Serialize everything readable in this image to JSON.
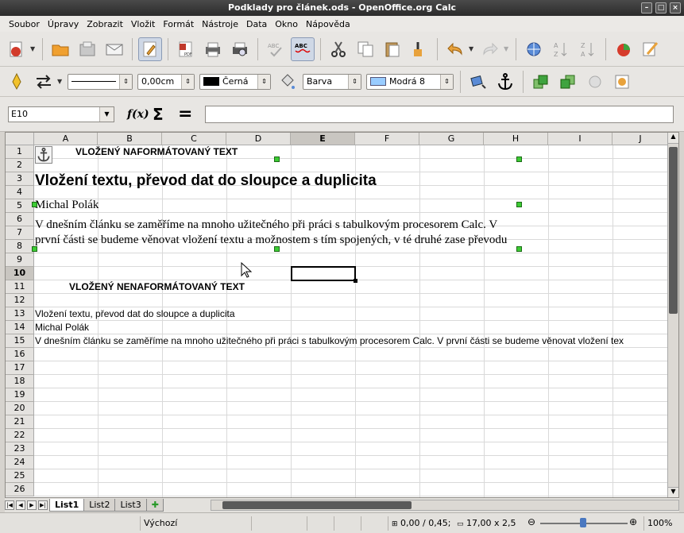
{
  "window": {
    "title": "Podklady pro článek.ods - OpenOffice.org Calc"
  },
  "menu": [
    {
      "label": "Soubor"
    },
    {
      "label": "Úpravy"
    },
    {
      "label": "Zobrazit"
    },
    {
      "label": "Vložit"
    },
    {
      "label": "Formát"
    },
    {
      "label": "Nástroje"
    },
    {
      "label": "Data"
    },
    {
      "label": "Okno"
    },
    {
      "label": "Nápověda"
    }
  ],
  "toolbar2": {
    "line_width": "0,00cm",
    "line_color": "Černá",
    "area_style": "Barva",
    "area_color": "Modrá 8"
  },
  "colors": {
    "line_color_swatch": "#000000",
    "area_color_swatch": "#99ccff",
    "handle": "#3ccb33"
  },
  "formula": {
    "cell_ref": "E10",
    "value": ""
  },
  "grid": {
    "columns": [
      "A",
      "B",
      "C",
      "D",
      "E",
      "F",
      "G",
      "H",
      "I",
      "J"
    ],
    "rows": [
      "1",
      "2",
      "3",
      "4",
      "5",
      "6",
      "7",
      "8",
      "9",
      "10",
      "11",
      "12",
      "13",
      "14",
      "15",
      "16",
      "17",
      "18",
      "19",
      "20",
      "21",
      "22",
      "23",
      "24",
      "25",
      "26"
    ],
    "selected_column": "E",
    "selected_row": "10",
    "texts": {
      "heading1": "VLOŽENÝ NAFORMÁTOVANÝ TEXT",
      "title_formatted": "Vložení textu, převod dat do sloupce a duplicita",
      "author_formatted": "Michal Polák",
      "para_formatted_1": "V dnešním článku se zaměříme na mnoho užitečného při práci s tabulkovým procesorem Calc. V",
      "para_formatted_2": "první části se budeme věnovat vložení textu a možnostem s tím spojených, v té druhé zase převodu",
      "heading2": "VLOŽENÝ NENAFORMÁTOVANÝ TEXT",
      "title_plain": "Vložení textu, převod dat do sloupce a duplicita",
      "author_plain": "Michal Polák",
      "para_plain": "V dnešním článku se zaměříme na mnoho užitečného při práci s tabulkovým procesorem Calc. V první části se budeme věnovat vložení tex"
    }
  },
  "sheets": [
    {
      "label": "List1",
      "active": true
    },
    {
      "label": "List2",
      "active": false
    },
    {
      "label": "List3",
      "active": false
    }
  ],
  "status": {
    "page_style": "Výchozí",
    "position": "0,00 / 0,45;",
    "size": "17,00 x 2,5",
    "zoom": "100%"
  }
}
